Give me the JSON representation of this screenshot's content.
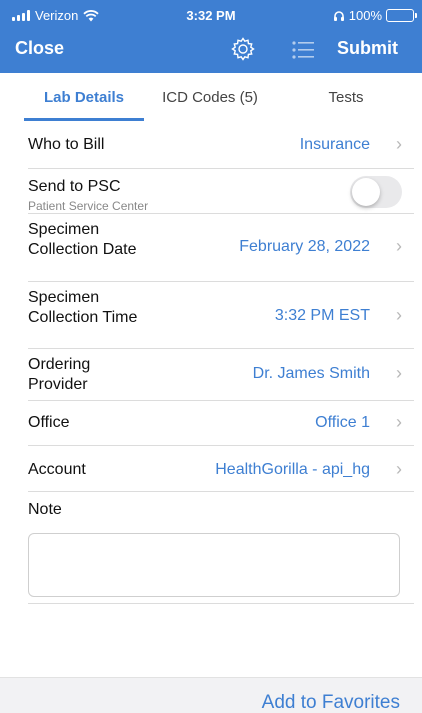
{
  "status_bar": {
    "carrier": "Verizon",
    "time": "3:32 PM",
    "battery": "100%",
    "icons": [
      "signal-bars-icon",
      "wifi-icon",
      "headphones-icon",
      "battery-charging-icon"
    ]
  },
  "navbar": {
    "close_label": "Close",
    "submit_label": "Submit",
    "icons": [
      "gear-icon",
      "list-icon"
    ]
  },
  "tabs": [
    {
      "label": "Lab Details",
      "active": true
    },
    {
      "label": "ICD Codes (5)",
      "active": false
    },
    {
      "label": "Tests",
      "active": false
    }
  ],
  "form": {
    "who_to_bill": {
      "label": "Who to Bill",
      "value": "Insurance"
    },
    "send_to_psc": {
      "label": "Send to PSC",
      "sublabel": "Patient Service Center",
      "enabled": false
    },
    "collection_date": {
      "label": "Specimen Collection Date",
      "value": "February 28, 2022"
    },
    "collection_time": {
      "label": "Specimen Collection Time",
      "value": "3:32 PM EST"
    },
    "ordering_provider": {
      "label": "Ordering Provider",
      "value": "Dr. James Smith"
    },
    "office": {
      "label": "Office",
      "value": "Office 1"
    },
    "account": {
      "label": "Account",
      "value": "HealthGorilla - api_hg"
    },
    "note": {
      "label": "Note",
      "value": ""
    }
  },
  "footer": {
    "add_to_favorites_label": "Add to Favorites"
  },
  "colors": {
    "accent": "#3e7fd2",
    "header_bg": "#3e7fd2",
    "toggle_off": "#e9e9eb",
    "battery_fill": "#4cd964"
  }
}
